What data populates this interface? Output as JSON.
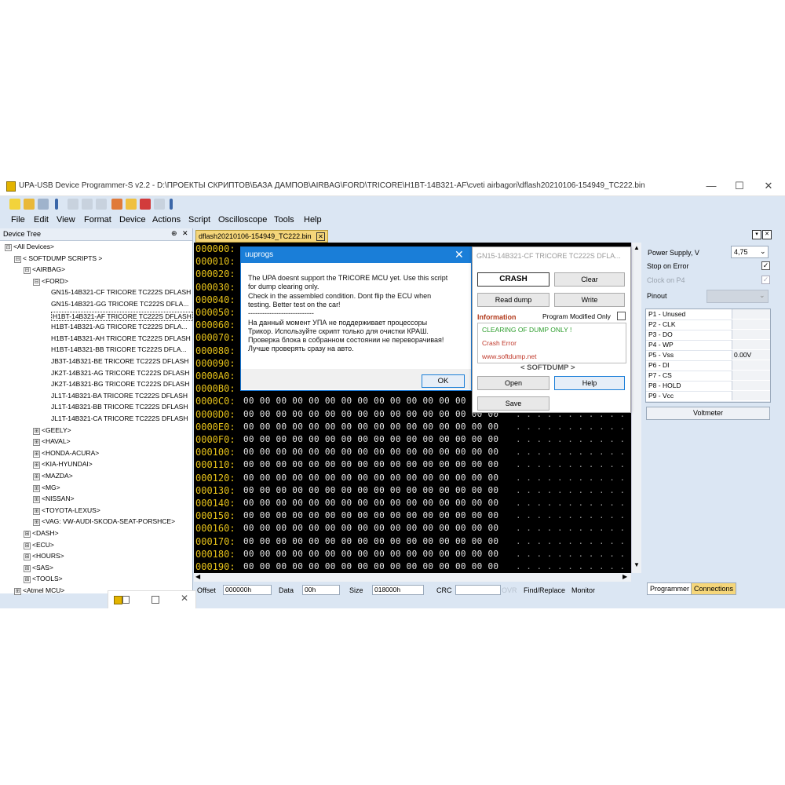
{
  "window": {
    "title": "UPA-USB Device Programmer-S v2.2 - D:\\ПРОЕКТЫ СКРИПТОВ\\БАЗА ДАМПОВ\\AIRBAG\\FORD\\TRICORE\\H1BT-14B321-AF\\cveti airbagori\\dflash20210106-154949_TC222.bin",
    "min": "—",
    "max": "☐",
    "close": "✕"
  },
  "menu": [
    "File",
    "Edit",
    "View",
    "Format",
    "Device",
    "Actions",
    "Script",
    "Oscilloscope",
    "Tools",
    "Help"
  ],
  "device_tree": {
    "header": "Device Tree",
    "pin": "⊕",
    "close": "✕",
    "nodes": [
      {
        "label": "<All Devices>",
        "level": 0,
        "exp": "⊟"
      },
      {
        "label": "< SOFTDUMP SCRIPTS >",
        "level": 1,
        "exp": "⊟"
      },
      {
        "label": "<AIRBAG>",
        "level": 2,
        "exp": "⊟"
      },
      {
        "label": "<FORD>",
        "level": 3,
        "exp": "⊟"
      },
      {
        "label": "GN15-14B321-CF TRICORE TC222S DFLASH",
        "level": 4,
        "exp": ""
      },
      {
        "label": "GN15-14B321-GG TRICORE TC222S DFLA...",
        "level": 4,
        "exp": ""
      },
      {
        "label": "H1BT-14B321-AF TRICORE TC222S DFLASH",
        "level": 4,
        "exp": "",
        "selected": true
      },
      {
        "label": "H1BT-14B321-AG TRICORE TC222S DFLA...",
        "level": 4,
        "exp": ""
      },
      {
        "label": "H1BT-14B321-AH TRICORE TC222S DFLASH",
        "level": 4,
        "exp": ""
      },
      {
        "label": "H1BT-14B321-BB  TRICORE TC222S DFLA...",
        "level": 4,
        "exp": ""
      },
      {
        "label": "JB3T-14B321-BE TRICORE TC222S DFLASH",
        "level": 4,
        "exp": ""
      },
      {
        "label": "JK2T-14B321-AG TRICORE TC222S DFLASH",
        "level": 4,
        "exp": ""
      },
      {
        "label": "JK2T-14B321-BG TRICORE TC222S DFLASH",
        "level": 4,
        "exp": ""
      },
      {
        "label": "JL1T-14B321-BA TRICORE TC222S DFLASH",
        "level": 4,
        "exp": ""
      },
      {
        "label": "JL1T-14B321-BB TRICORE TC222S DFLASH",
        "level": 4,
        "exp": ""
      },
      {
        "label": "JL1T-14B321-CA TRICORE TC222S DFLASH",
        "level": 4,
        "exp": ""
      },
      {
        "label": "<GEELY>",
        "level": 3,
        "exp": "⊞"
      },
      {
        "label": "<HAVAL>",
        "level": 3,
        "exp": "⊞"
      },
      {
        "label": "<HONDA-ACURA>",
        "level": 3,
        "exp": "⊞"
      },
      {
        "label": "<KIA-HYUNDAI>",
        "level": 3,
        "exp": "⊞"
      },
      {
        "label": "<MAZDA>",
        "level": 3,
        "exp": "⊞"
      },
      {
        "label": "<MG>",
        "level": 3,
        "exp": "⊞"
      },
      {
        "label": "<NISSAN>",
        "level": 3,
        "exp": "⊞"
      },
      {
        "label": "<TOYOTA-LEXUS>",
        "level": 3,
        "exp": "⊞"
      },
      {
        "label": "<VAG: VW-AUDI-SKODA-SEAT-PORSHCE>",
        "level": 3,
        "exp": "⊞"
      },
      {
        "label": "<DASH>",
        "level": 2,
        "exp": "⊞"
      },
      {
        "label": "<ECU>",
        "level": 2,
        "exp": "⊞"
      },
      {
        "label": "<HOURS>",
        "level": 2,
        "exp": "⊞"
      },
      {
        "label": "<SAS>",
        "level": 2,
        "exp": "⊞"
      },
      {
        "label": "<TOOLS>",
        "level": 2,
        "exp": "⊞"
      },
      {
        "label": "<Atmel MCU>",
        "level": 1,
        "exp": "⊞"
      }
    ]
  },
  "editor": {
    "tab_label": "dflash20210106-154949_TC222.bin",
    "tab_close": "✕",
    "panel_buttons": [
      "▾",
      "✕"
    ],
    "rows": [
      {
        "addr": "000000:",
        "bytes": ""
      },
      {
        "addr": "000010:",
        "bytes": ""
      },
      {
        "addr": "000020:",
        "bytes": ""
      },
      {
        "addr": "000030:",
        "bytes": ""
      },
      {
        "addr": "000040:",
        "bytes": ""
      },
      {
        "addr": "000050:",
        "bytes": ""
      },
      {
        "addr": "000060:",
        "bytes": ""
      },
      {
        "addr": "000070:",
        "bytes": ""
      },
      {
        "addr": "000080:",
        "bytes": ""
      },
      {
        "addr": "000090:",
        "bytes": ""
      },
      {
        "addr": "0000A0:",
        "bytes": ""
      },
      {
        "addr": "0000B0:",
        "bytes": ""
      },
      {
        "addr": "0000C0:",
        "bytes": "00 00 00 00 00 00 00 00 00 00 00 00 00 00 00 00",
        "ascii": ". . . . . . . . . . . . . . . ."
      },
      {
        "addr": "0000D0:",
        "bytes": "00 00 00 00 00 00 00 00 00 00 00 00 00 00 00 00",
        "ascii": ". . . . . . . . . . . . . . . ."
      },
      {
        "addr": "0000E0:",
        "bytes": "00 00 00 00 00 00 00 00 00 00 00 00 00 00 00 00",
        "ascii": ". . . . . . . . . . . . . . . ."
      },
      {
        "addr": "0000F0:",
        "bytes": "00 00 00 00 00 00 00 00 00 00 00 00 00 00 00 00",
        "ascii": ". . . . . . . . . . . . . . . ."
      },
      {
        "addr": "000100:",
        "bytes": "00 00 00 00 00 00 00 00 00 00 00 00 00 00 00 00",
        "ascii": ". . . . . . . . . . . . . . . ."
      },
      {
        "addr": "000110:",
        "bytes": "00 00 00 00 00 00 00 00 00 00 00 00 00 00 00 00",
        "ascii": ". . . . . . . . . . . . . . . ."
      },
      {
        "addr": "000120:",
        "bytes": "00 00 00 00 00 00 00 00 00 00 00 00 00 00 00 00",
        "ascii": ". . . . . . . . . . . . . . . ."
      },
      {
        "addr": "000130:",
        "bytes": "00 00 00 00 00 00 00 00 00 00 00 00 00 00 00 00",
        "ascii": ". . . . . . . . . . . . . . . ."
      },
      {
        "addr": "000140:",
        "bytes": "00 00 00 00 00 00 00 00 00 00 00 00 00 00 00 00",
        "ascii": ". . . . . . . . . . . . . . . ."
      },
      {
        "addr": "000150:",
        "bytes": "00 00 00 00 00 00 00 00 00 00 00 00 00 00 00 00",
        "ascii": ". . . . . . . . . . . . . . . ."
      },
      {
        "addr": "000160:",
        "bytes": "00 00 00 00 00 00 00 00 00 00 00 00 00 00 00 00",
        "ascii": ". . . . . . . . . . . . . . . ."
      },
      {
        "addr": "000170:",
        "bytes": "00 00 00 00 00 00 00 00 00 00 00 00 00 00 00 00",
        "ascii": ". . . . . . . . . . . . . . . ."
      },
      {
        "addr": "000180:",
        "bytes": "00 00 00 00 00 00 00 00 00 00 00 00 00 00 00 00",
        "ascii": ". . . . . . . . . . . . . . . ."
      },
      {
        "addr": "000190:",
        "bytes": "00 00 00 00 00 00 00 00 00 00 00 00 00 00 00 00",
        "ascii": ". . . . . . . . . . . . . . . ."
      }
    ]
  },
  "statusbar": {
    "offset_label": "Offset",
    "offset_value": "000000h",
    "data_label": "Data",
    "data_value": "00h",
    "size_label": "Size",
    "size_value": "018000h",
    "crc_label": "CRC",
    "crc_value": "",
    "ovr": "OVR",
    "find_replace": "Find/Replace",
    "monitor": "Monitor"
  },
  "right_panel": {
    "power_label": "Power Supply, V",
    "power_value": "4,75",
    "stop_on_error": "Stop on Error",
    "clock_p4": "Clock on P4",
    "pinout": "Pinout",
    "pins": [
      {
        "name": "P1 - Unused",
        "value": ""
      },
      {
        "name": "P2 - CLK",
        "value": ""
      },
      {
        "name": "P3 - DO",
        "value": ""
      },
      {
        "name": "P4 - WP",
        "value": ""
      },
      {
        "name": "P5 -  Vss",
        "value": "0.00V"
      },
      {
        "name": "P6 - DI",
        "value": ""
      },
      {
        "name": "P7 - CS",
        "value": ""
      },
      {
        "name": "P8 - HOLD",
        "value": ""
      },
      {
        "name": "P9 - Vcc",
        "value": ""
      }
    ],
    "voltmeter": "Voltmeter",
    "tab_programmer": "Programmer",
    "tab_connections": "Connections"
  },
  "message_dialog": {
    "title": "uuprogs",
    "close": "✕",
    "lines": [
      "The UPA doesnt support the TRICORE MCU yet. Use this script",
      "for dump clearing only.",
      "Check in the assembled condition. Dont flip the ECU when",
      "testing. Better test on the car!",
      "----------------------------",
      "На данный момент УПА не поддерживает процессоры",
      "Трикор. Используйте скрипт только для очистки КРАШ.",
      "Проверка блока в собранном состоянии не переворачивая!",
      "Лучше проверять сразу на авто."
    ],
    "ok": "OK"
  },
  "script_window": {
    "title": "GN15-14B321-CF TRICORE TC222S DFLA...",
    "crash": "CRASH",
    "clear": "Clear",
    "read_dump": "Read dump",
    "write": "Write",
    "information": "Information",
    "program_modified": "Program Modified Only",
    "info_lines": [
      "CLEARING OF DUMP ONLY !",
      "Crash Error",
      "www.softdump.net"
    ],
    "softdump": "< SOFTDUMP >",
    "open": "Open",
    "help": "Help",
    "save": "Save"
  },
  "colors": {
    "accent": "#1a7ed8",
    "hex_addr": "#e6c21a",
    "crash_red": "#c0392b",
    "info_green": "#2e9e2e"
  }
}
